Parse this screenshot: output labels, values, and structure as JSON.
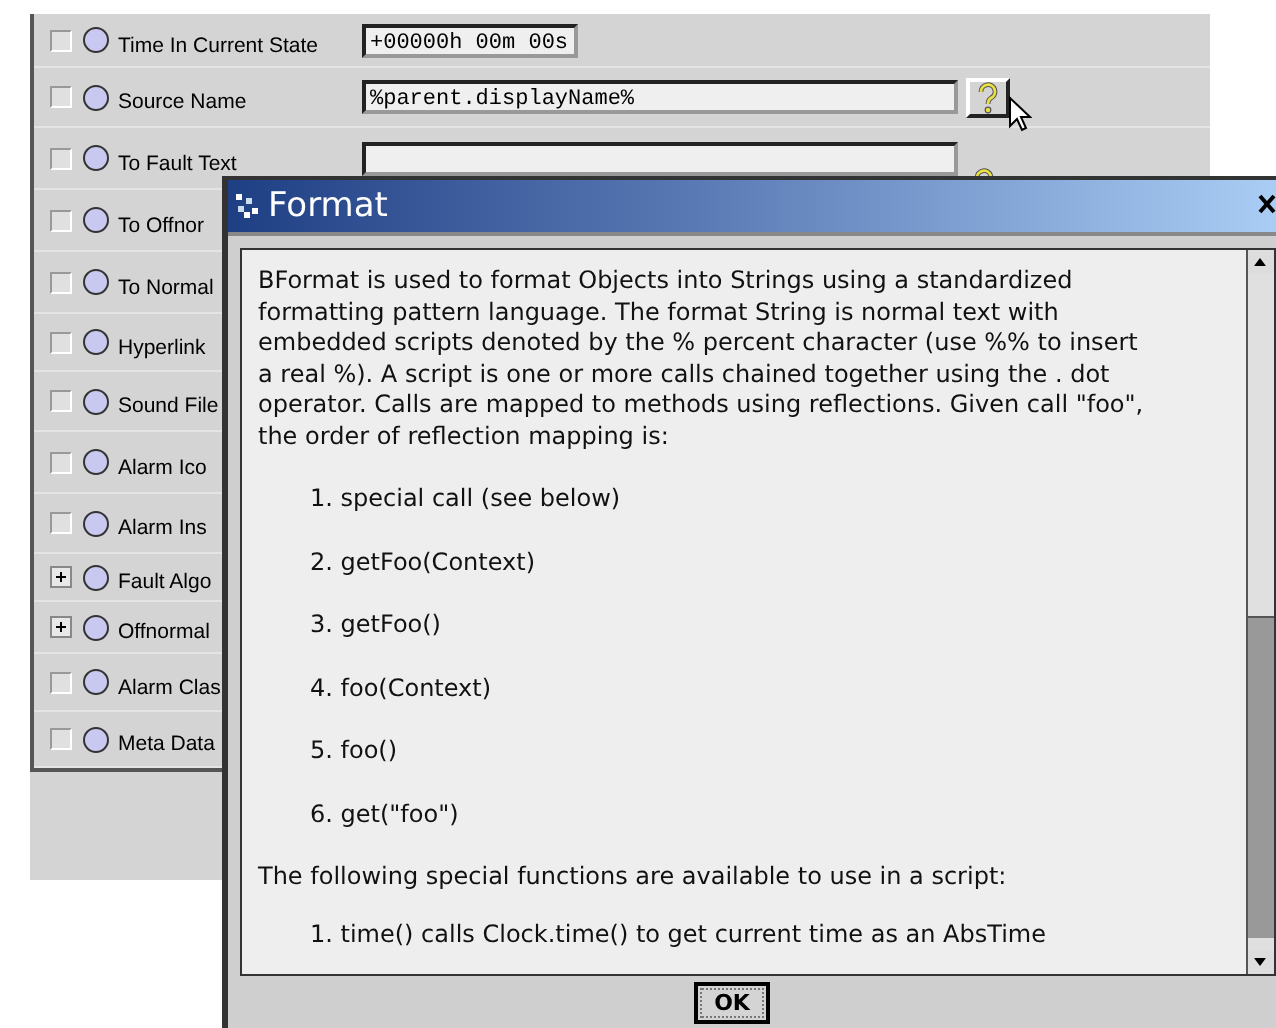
{
  "properties": [
    {
      "label": "Time In Current State",
      "kind": "check",
      "checked": false,
      "value": "+00000h 00m 00s"
    },
    {
      "label": "Source Name",
      "kind": "check",
      "checked": false,
      "value": "%parent.displayName%"
    },
    {
      "label": "To Fault Text",
      "kind": "check",
      "checked": false
    },
    {
      "label": "To Offnor",
      "kind": "check",
      "checked": false
    },
    {
      "label": "To Normal",
      "kind": "check",
      "checked": false
    },
    {
      "label": "Hyperlink",
      "kind": "check",
      "checked": false
    },
    {
      "label": "Sound File",
      "kind": "check",
      "checked": false
    },
    {
      "label": "Alarm Ico",
      "kind": "check",
      "checked": false
    },
    {
      "label": "Alarm Ins",
      "kind": "check",
      "checked": false
    },
    {
      "label": "Fault Algo",
      "kind": "expand",
      "expanded": false
    },
    {
      "label": "Offnormal",
      "kind": "expand",
      "expanded": false
    },
    {
      "label": "Alarm Clas",
      "kind": "check",
      "checked": false
    },
    {
      "label": "Meta Data",
      "kind": "check",
      "checked": false
    }
  ],
  "dialog": {
    "title": "Format",
    "intro": "BFormat is used to format Objects into Strings using a standardized\nformatting pattern language. The format String is normal text with\nembedded scripts denoted by the % percent character (use %% to insert\na real %). A script is one or more calls chained together using the . dot\noperator. Calls are mapped to methods using reflections. Given call \"foo\",\nthe order of reflection mapping is:",
    "order": [
      "1. special call (see below)",
      "2. getFoo(Context)",
      "3. getFoo()",
      "4. foo(Context)",
      "5. foo()",
      "6. get(\"foo\")"
    ],
    "special_intro": "The following special functions are available to use in a script:",
    "special": [
      "1. time() calls Clock.time() to get current time as an AbsTime"
    ],
    "buttons": [
      "OK"
    ]
  }
}
